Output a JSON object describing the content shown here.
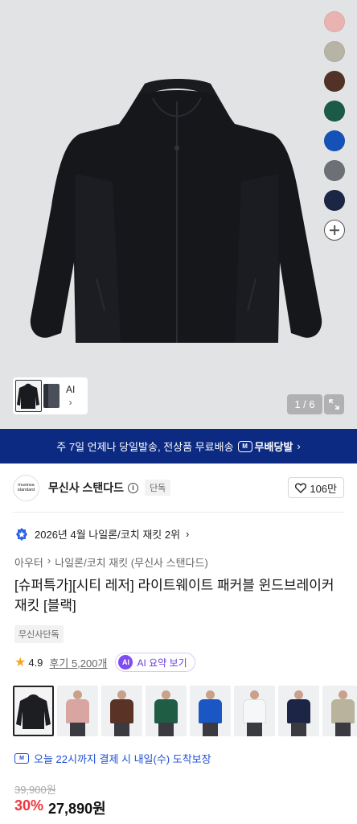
{
  "hero": {
    "swatch_colors": [
      "#e8b3b0",
      "#b7b4a6",
      "#523226",
      "#1b5a45",
      "#1552b8",
      "#6d7075",
      "#1b2645"
    ],
    "page_indicator": "1 / 6",
    "thumb_ai_label": "AI"
  },
  "banner": {
    "text": "주 7일 언제나 당일발송, 전상품 무료배송",
    "badge_label": "무배당발",
    "badge_icon_text": "M"
  },
  "brand": {
    "logo_line1": "musinsa",
    "logo_line2": "standard",
    "name": "무신사 스탠다드",
    "exclusive_tag": "단독",
    "like_count": "106만"
  },
  "rank": {
    "text": "2026년 4월 나일론/코치 재킷 2위"
  },
  "category": {
    "level1": "아우터",
    "level2": "나일론/코치 재킷 (무신사 스탠다드)"
  },
  "product": {
    "title": "[슈퍼특가][시티 레저] 라이트웨이트 패커블 윈드브레이커 재킷 [블랙]",
    "tag": "무신사단독",
    "rating": "4.9",
    "review_text": "후기 5,200개",
    "ai_badge": "AI",
    "ai_summary_label": "AI 요약 보기"
  },
  "color_options": [
    {
      "name": "black",
      "color": "#1d1e22",
      "selected": true
    },
    {
      "name": "pink",
      "color": "#d9a5a1"
    },
    {
      "name": "brown",
      "color": "#5a3326"
    },
    {
      "name": "green",
      "color": "#1f5e45"
    },
    {
      "name": "blue",
      "color": "#1a56c4"
    },
    {
      "name": "white",
      "color": "#eef0f3"
    },
    {
      "name": "navy",
      "color": "#1c2546"
    },
    {
      "name": "beige",
      "color": "#b9b29c"
    }
  ],
  "delivery": {
    "text": "오늘 22시까지 결제 시 내일(수) 도착보장",
    "icon_text": "M"
  },
  "price": {
    "original": "39,900원",
    "discount": "30%",
    "final": "27,890원"
  }
}
